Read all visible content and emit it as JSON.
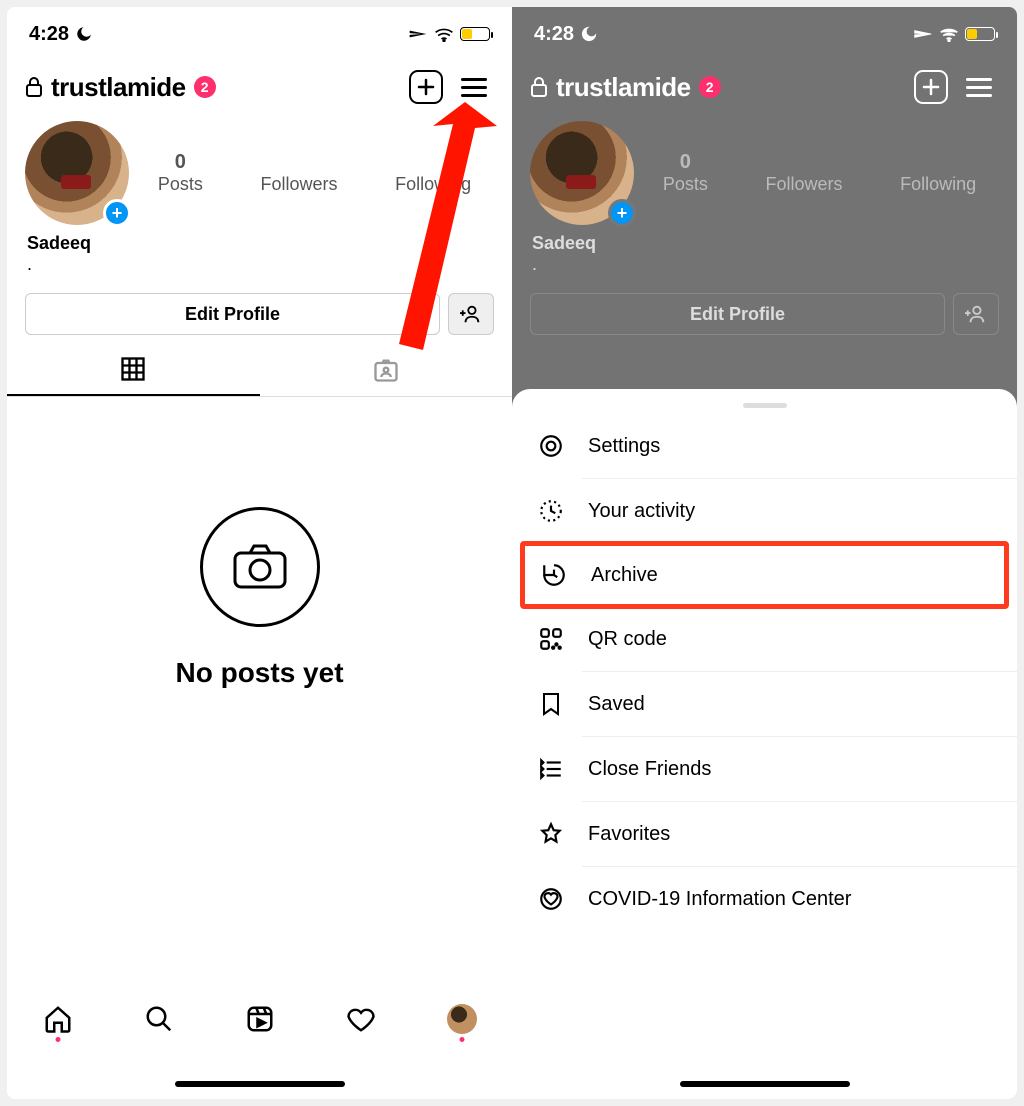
{
  "status": {
    "time": "4:28"
  },
  "profile": {
    "username": "trustlamide",
    "notification_count": "2",
    "display_name": "Sadeeq",
    "bio": "."
  },
  "stats": {
    "posts_count": "0",
    "posts_label": "Posts",
    "followers_label": "Followers",
    "following_label": "Following"
  },
  "actions": {
    "edit_profile": "Edit Profile"
  },
  "empty": {
    "no_posts": "No posts yet"
  },
  "menu": {
    "items": [
      {
        "label": "Settings"
      },
      {
        "label": "Your activity"
      },
      {
        "label": "Archive"
      },
      {
        "label": "QR code"
      },
      {
        "label": "Saved"
      },
      {
        "label": "Close Friends"
      },
      {
        "label": "Favorites"
      },
      {
        "label": "COVID-19 Information Center"
      }
    ],
    "highlight_index": 2
  }
}
